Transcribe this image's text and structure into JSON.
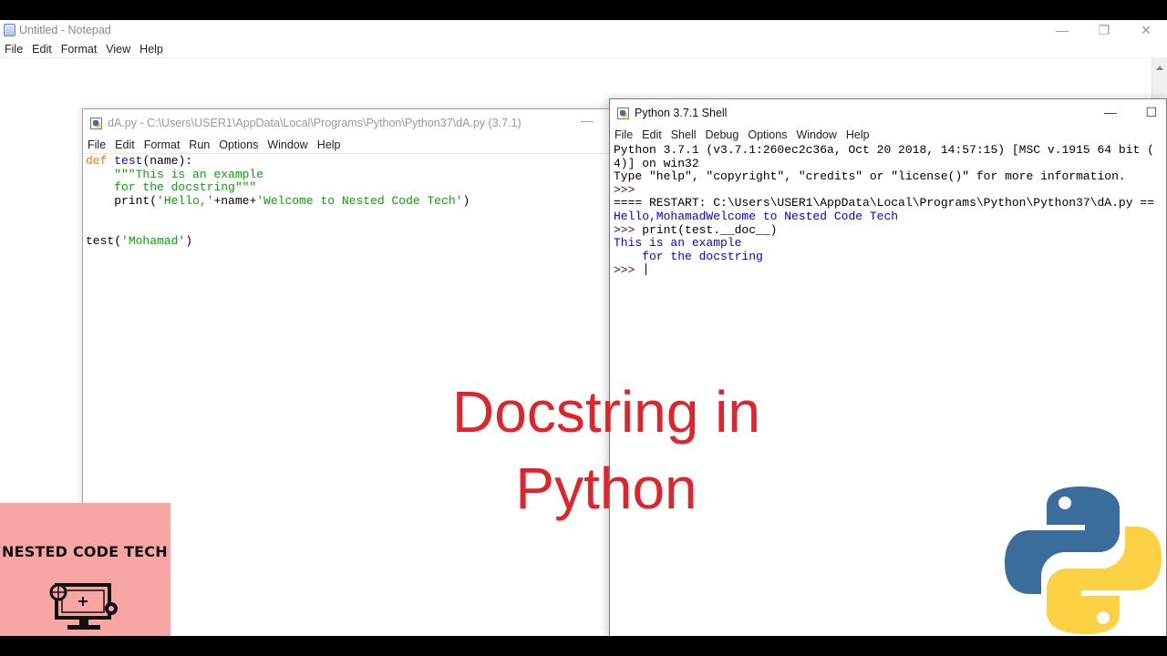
{
  "notepad": {
    "title": "Untitled - Notepad",
    "menu": [
      "File",
      "Edit",
      "Format",
      "View",
      "Help"
    ],
    "controls": {
      "minimize": "—",
      "restore": "❐",
      "close": "✕"
    }
  },
  "editor": {
    "title": "dA.py - C:\\Users\\USER1\\AppData\\Local\\Programs\\Python\\Python37\\dA.py (3.7.1)",
    "menu": [
      "File",
      "Edit",
      "Format",
      "Run",
      "Options",
      "Window",
      "Help"
    ],
    "minimize": "—",
    "code": {
      "l1_kw": "def ",
      "l1_fn": "test",
      "l1_rest": "(name):",
      "l2": "    \"\"\"This is an example",
      "l3": "    for the docstring\"\"\"",
      "l4_pre": "    print(",
      "l4_s1": "'Hello,'",
      "l4_mid": "+name+",
      "l4_s2": "'Welcome to Nested Code Tech'",
      "l4_post": ")",
      "l7_pre": "test(",
      "l7_s": "'Mohamad'",
      "l7_post": ")"
    }
  },
  "shell": {
    "title": "Python 3.7.1 Shell",
    "menu": [
      "File",
      "Edit",
      "Shell",
      "Debug",
      "Options",
      "Window",
      "Help"
    ],
    "controls": {
      "minimize": "—",
      "maximize": "☐"
    },
    "lines": {
      "banner1": "Python 3.7.1 (v3.7.1:260ec2c36a, Oct 20 2018, 14:57:15) [MSC v.1915 64 bit (",
      "banner2": "4)] on win32",
      "banner3": "Type \"help\", \"copyright\", \"credits\" or \"license()\" for more information.",
      "prompt": ">>> ",
      "restart": "==== RESTART: C:\\Users\\USER1\\AppData\\Local\\Programs\\Python\\Python37\\dA.py ==",
      "out1": "Hello,MohamadWelcome to Nested Code Tech",
      "cmd": "print(test.__doc__)",
      "out2": "This is an example",
      "out3": "    for the docstring"
    }
  },
  "overlay": {
    "line1": "Docstring in",
    "line2": "Python"
  },
  "badge": {
    "name": "NESTED CODE TECH"
  },
  "colors": {
    "overlay_text": "#e0242b",
    "badge_bg": "#f7a5a5",
    "python_blue": "#3a6d9c",
    "python_yellow": "#fcd144"
  }
}
